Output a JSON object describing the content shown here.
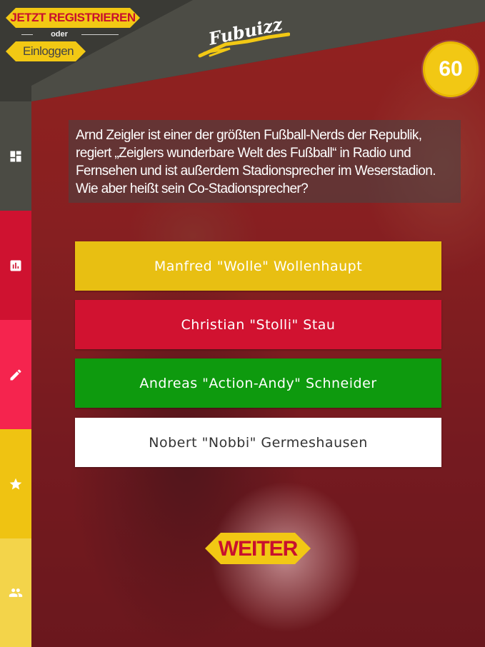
{
  "header": {
    "register_label": "JETZT REGISTRIEREN",
    "or_label": "oder",
    "login_label": "Einloggen",
    "logo_text": "Fubuizz"
  },
  "timer": {
    "value": "60"
  },
  "sidebar": {
    "items": [
      {
        "icon": "dashboard-icon",
        "color": "#4b4b44"
      },
      {
        "icon": "bar-chart-icon",
        "color": "#cf1230"
      },
      {
        "icon": "pencil-icon",
        "color": "#f5244e"
      },
      {
        "icon": "star-icon",
        "color": "#efc312"
      },
      {
        "icon": "people-icon",
        "color": "#f3d44a"
      }
    ]
  },
  "question": {
    "text": "Arnd Zeigler ist einer der größten Fußball-Nerds der Republik, regiert „Zeiglers wunderbare Welt des Fußball“ in Radio und Fernsehen und ist außerdem Stadionsprecher im Weserstadion. Wie aber heißt sein Co-Stadionsprecher?"
  },
  "answers": [
    {
      "label": "Manfred \"Wolle\" Wollenhaupt",
      "color": "#e8bf12"
    },
    {
      "label": "Christian \"Stolli\" Stau",
      "color": "#d11230"
    },
    {
      "label": "Andreas \"Action-Andy\" Schneider",
      "color": "#0e9a0e"
    },
    {
      "label": "Nobert \"Nobbi\" Germeshausen",
      "color": "#ffffff"
    }
  ],
  "next_label": "WEITER",
  "colors": {
    "accent": "#f2c814",
    "brand_red": "#c8102e",
    "header_dark": "#3a3a35"
  }
}
